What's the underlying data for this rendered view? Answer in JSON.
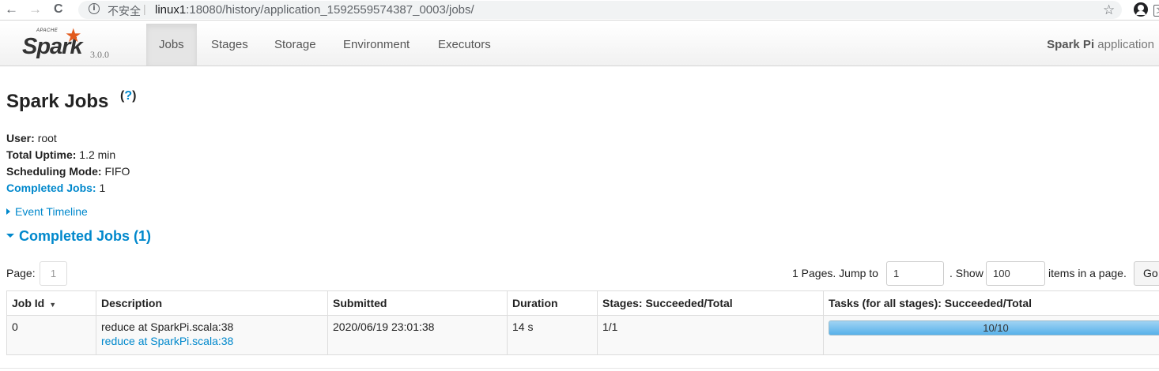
{
  "browser": {
    "back": "←",
    "forward": "→",
    "reload": "C",
    "insecure_label": "不安全",
    "url_host": "linux1",
    "url_rest": ":18080/history/application_1592559574387_0003/jobs/",
    "translate_icon": "translate-icon",
    "star": "☆"
  },
  "navbar": {
    "logo_apache": "APACHE",
    "logo_text": "Spark",
    "version": "3.0.0",
    "tabs": [
      {
        "label": "Jobs",
        "active": true
      },
      {
        "label": "Stages",
        "active": false
      },
      {
        "label": "Storage",
        "active": false
      },
      {
        "label": "Environment",
        "active": false
      },
      {
        "label": "Executors",
        "active": false
      }
    ],
    "app_name_bold": "Spark Pi",
    "app_name_rest": "application"
  },
  "page": {
    "title": "Spark Jobs",
    "help_open": "(",
    "help_q": "?",
    "help_close": ")",
    "summary": {
      "user_label": "User:",
      "user_value": "root",
      "uptime_label": "Total Uptime:",
      "uptime_value": "1.2 min",
      "mode_label": "Scheduling Mode:",
      "mode_value": "FIFO",
      "completed_label": "Completed Jobs:",
      "completed_value": "1"
    },
    "event_timeline": "Event Timeline",
    "completed_heading": "Completed Jobs (1)"
  },
  "pagination": {
    "page_label": "Page:",
    "page_number": "1",
    "pages_text": "1 Pages. Jump to",
    "jump_value": "1",
    "show_text": ". Show",
    "show_value": "100",
    "items_text": "items in a page.",
    "go_label": "Go"
  },
  "table": {
    "headers": [
      "Job Id",
      "Description",
      "Submitted",
      "Duration",
      "Stages: Succeeded/Total",
      "Tasks (for all stages): Succeeded/Total"
    ],
    "sort_arrow": "▼",
    "rows": [
      {
        "job_id": "0",
        "description": "reduce at SparkPi.scala:38",
        "description_link": "reduce at SparkPi.scala:38",
        "submitted": "2020/06/19 23:01:38",
        "duration": "14 s",
        "stages": "1/1",
        "tasks": "10/10",
        "tasks_fraction": 1.0
      }
    ]
  },
  "colors": {
    "link": "#0088cc",
    "progress": "#5db5ec",
    "spark_orange": "#e25a1c"
  }
}
